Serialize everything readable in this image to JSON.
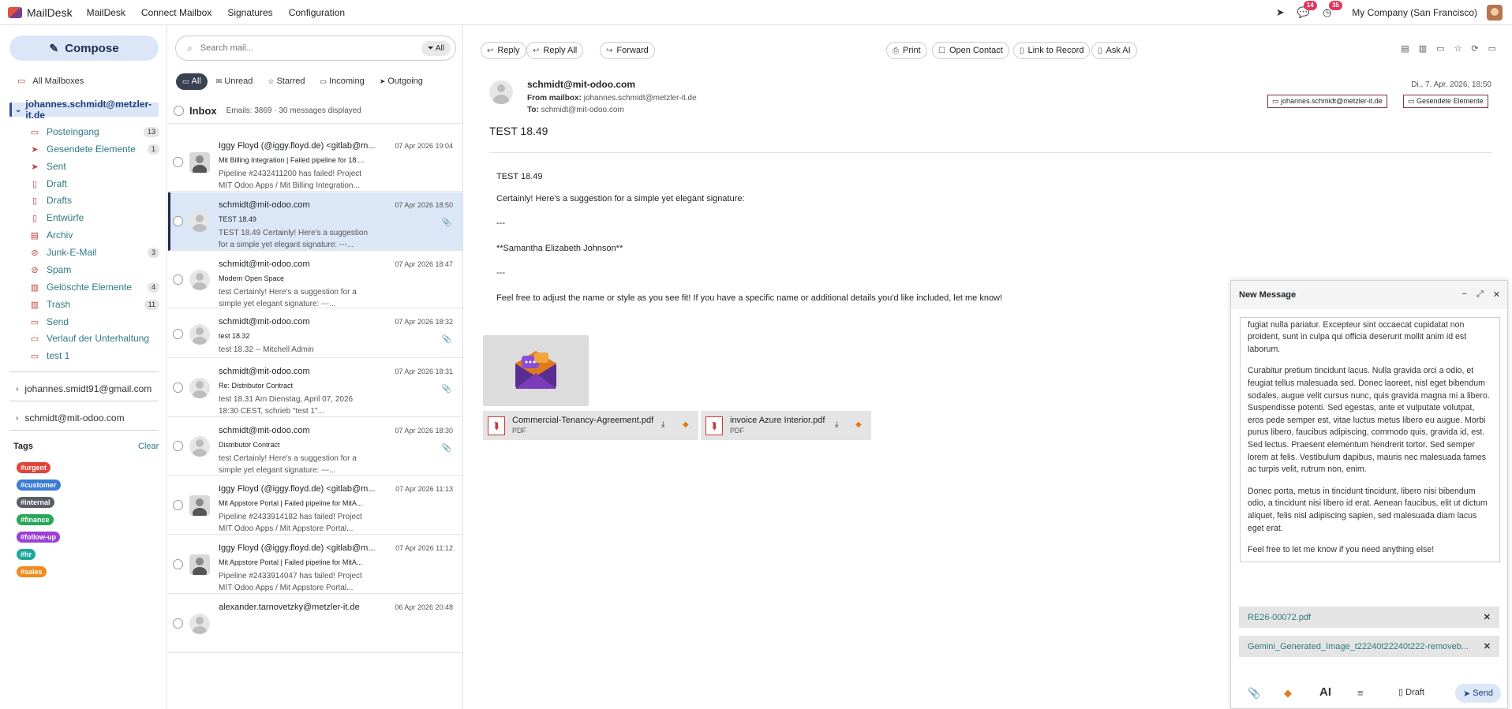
{
  "app": {
    "name": "MailDesk",
    "menu": [
      "MailDesk",
      "Connect Mailbox",
      "Signatures",
      "Configuration"
    ],
    "messages_badge": "14",
    "activity_badge": "35",
    "company": "My Company (San Francisco)"
  },
  "sidebar": {
    "compose_label": "Compose",
    "all_mailboxes": "All Mailboxes",
    "active_account": "johannes.schmidt@metzler-it.de",
    "folders": [
      {
        "label": "Posteingang",
        "count": "13",
        "icon": "inbox-icon"
      },
      {
        "label": "Gesendete Elemente",
        "count": "1",
        "icon": "send-icon"
      },
      {
        "label": "Sent",
        "count": "",
        "icon": "send-icon"
      },
      {
        "label": "Draft",
        "count": "",
        "icon": "draft-icon"
      },
      {
        "label": "Drafts",
        "count": "",
        "icon": "draft-icon"
      },
      {
        "label": "Entwürfe",
        "count": "",
        "icon": "draft-icon"
      },
      {
        "label": "Archiv",
        "count": "",
        "icon": "archive-icon"
      },
      {
        "label": "Junk-E-Mail",
        "count": "3",
        "icon": "ban-icon"
      },
      {
        "label": "Spam",
        "count": "",
        "icon": "ban-icon"
      },
      {
        "label": "Gelöschte Elemente",
        "count": "4",
        "icon": "trash-icon"
      },
      {
        "label": "Trash",
        "count": "11",
        "icon": "trash-icon"
      },
      {
        "label": "Send",
        "count": "",
        "icon": "folder-icon"
      },
      {
        "label": "Verlauf der Unterhaltung",
        "count": "",
        "icon": "folder-icon"
      },
      {
        "label": "test 1",
        "count": "",
        "icon": "folder-icon"
      }
    ],
    "other_accounts": [
      "johannes.smidt91@gmail.com",
      "schmidt@mit-odoo.com"
    ],
    "tags_title": "Tags",
    "tags_clear": "Clear",
    "tags": [
      {
        "label": "#urgent",
        "color": "#e0443a"
      },
      {
        "label": "#customer",
        "color": "#3a7bd5"
      },
      {
        "label": "#internal",
        "color": "#5a5f66"
      },
      {
        "label": "#finance",
        "color": "#27a85a"
      },
      {
        "label": "#follow-up",
        "color": "#9b3fd6"
      },
      {
        "label": "#hr",
        "color": "#1fa89e"
      },
      {
        "label": "#sales",
        "color": "#f08c1f"
      }
    ]
  },
  "list": {
    "search_placeholder": "Search mail...",
    "search_scope": "All",
    "filters": [
      "All",
      "Unread",
      "Starred",
      "Incoming",
      "Outgoing"
    ],
    "folder_title": "Inbox",
    "folder_info": "Emails: 3869 · 30 messages displayed",
    "items": [
      {
        "from": "Iggy Floyd (@iggy.floyd.de) <gitlab@m...",
        "date": "07 Apr 2026 19:04",
        "subject": "Mit Billing Integration | Failed pipeline for 18....",
        "preview": "Pipeline #2432411200 has failed! Project MIT Odoo Apps / Mit Billing Integration...",
        "attachment": false
      },
      {
        "from": "schmidt@mit-odoo.com",
        "date": "07 Apr 2026 18:50",
        "subject": "TEST 18.49",
        "preview": "TEST 18.49 Certainly! Here's a suggestion for a simple yet elegant signature: ---...",
        "attachment": true
      },
      {
        "from": "schmidt@mit-odoo.com",
        "date": "07 Apr 2026 18:47",
        "subject": "Modern Open Space",
        "preview": "test Certainly! Here's a suggestion for a simple yet elegant signature: ---...",
        "attachment": false
      },
      {
        "from": "schmidt@mit-odoo.com",
        "date": "07 Apr 2026 18:32",
        "subject": "test 18.32",
        "preview": "test 18.32 -- Mitchell Admin",
        "attachment": true
      },
      {
        "from": "schmidt@mit-odoo.com",
        "date": "07 Apr 2026 18:31",
        "subject": "Re: Distributor Contract",
        "preview": "test 18.31 Am Dienstag, April 07, 2026 18:30 CEST, schrieb \"test 1\"...",
        "attachment": true
      },
      {
        "from": "schmidt@mit-odoo.com",
        "date": "07 Apr 2026 18:30",
        "subject": "Distributor Contract",
        "preview": "test Certainly! Here's a suggestion for a simple yet elegant signature: ---...",
        "attachment": true
      },
      {
        "from": "Iggy Floyd (@iggy.floyd.de) <gitlab@m...",
        "date": "07 Apr 2026 11:13",
        "subject": "Mit Appstore Portal | Failed pipeline for MitA...",
        "preview": "Pipeline #2433914182 has failed! Project MIT Odoo Apps / Mit Appstore Portal...",
        "attachment": false
      },
      {
        "from": "Iggy Floyd (@iggy.floyd.de) <gitlab@m...",
        "date": "07 Apr 2026 11:12",
        "subject": "Mit Appstore Portal | Failed pipeline for MitA...",
        "preview": "Pipeline #2433914047 has failed! Project MIT Odoo Apps / Mit Appstore Portal...",
        "attachment": false
      },
      {
        "from": "alexander.tarnovetzky@metzler-it.de",
        "date": "06 Apr 2026 20:48",
        "subject": "",
        "preview": "",
        "attachment": false
      }
    ]
  },
  "reader": {
    "toolbar": [
      "Reply",
      "Reply All",
      "Forward",
      "Print",
      "Open Contact",
      "Link to Record",
      "Ask AI"
    ],
    "from": "schmidt@mit-odoo.com",
    "mailbox_label": "From mailbox:",
    "mailbox": "johannes.schmidt@metzler-it.de",
    "to_label": "To:",
    "to": "schmidt@mit-odoo.com",
    "date": "Di., 7. Apr. 2026, 18:50",
    "chips": [
      "johannes.schmidt@metzler-it.de",
      "Gesendete Elemente"
    ],
    "subject": "TEST 18.49",
    "body": [
      "TEST 18.49",
      "Certainly! Here's a suggestion for a simple yet elegant signature:",
      "---",
      "**Samantha Elizabeth Johnson**",
      "---",
      "Feel free to adjust the name or style as you see fit! If you have a specific name or additional details you'd like included, let me know!"
    ],
    "attachments": [
      {
        "name": "Commercial-Tenancy-Agreement.pdf",
        "type": "PDF"
      },
      {
        "name": "invoice Azure Interior.pdf",
        "type": "PDF"
      }
    ]
  },
  "compose": {
    "title": "New Message",
    "paragraphs": [
      "irure dolor in reprehenderit in voluptate velit esse cillum dolore eu fugiat nulla pariatur. Excepteur sint occaecat cupidatat non proident, sunt in culpa qui officia deserunt mollit anim id est laborum.",
      "Curabitur pretium tincidunt lacus. Nulla gravida orci a odio, et feugiat tellus malesuada sed. Donec laoreet, nisl eget bibendum sodales, augue velit cursus nunc, quis gravida magna mi a libero. Suspendisse potenti. Sed egestas, ante et vulputate volutpat, eros pede semper est, vitae luctus metus libero eu augue. Morbi purus libero, faucibus adipiscing, commodo quis, gravida id, est. Sed lectus. Praesent elementum hendrerit tortor. Sed semper lorem at felis. Vestibulum dapibus, mauris nec malesuada fames ac turpis velit, rutrum non, enim.",
      "Donec porta, metus in tincidunt tincidunt, libero nisi bibendum odio, a tincidunt nisi libero id erat. Aenean faucibus, elit ut dictum aliquet, felis nisl adipiscing sapien, sed malesuada diam lacus eget erat.",
      "Feel free to let me know if you need anything else!"
    ],
    "attachments": [
      "RE26-00072.pdf",
      "Gemini_Generated_Image_t22240t22240t222-removeb..."
    ],
    "ai_label": "AI",
    "draft_label": "Draft",
    "send_label": "Send"
  }
}
